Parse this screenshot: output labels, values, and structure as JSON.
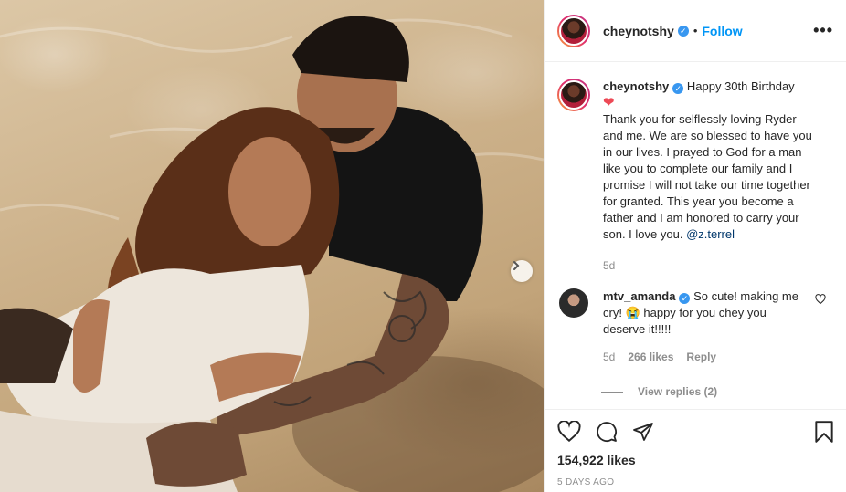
{
  "post": {
    "photo_alt": "photo",
    "next_icon": "chevron-right-icon"
  },
  "header": {
    "username": "cheynotshy",
    "verified_glyph": "✓",
    "separator": "•",
    "follow_label": "Follow",
    "more_label": "•••"
  },
  "caption": {
    "username": "cheynotshy",
    "first_line": "Happy 30th Birthday",
    "heart": "❤",
    "text": "Thank you for selflessly loving Ryder and me. We are so blessed to have you in our lives. I prayed to God for a man like you to complete our family and I promise I will not take our time together for granted. This year you become a father and I am honored to carry your son. I love you.",
    "mention": "@z.terrel",
    "time": "5d"
  },
  "comment": {
    "username": "mtv_amanda",
    "text_before_emoji": "So cute! making me cry!",
    "emoji": "😭",
    "text_after_emoji": "happy for you chey you deserve it!!!!!",
    "time": "5d",
    "likes": "266 likes",
    "reply_label": "Reply",
    "view_replies": "View replies (2)"
  },
  "footer": {
    "likes": "154,922 likes",
    "date": "5 DAYS AGO"
  },
  "colors": {
    "accent": "#0095f6",
    "verified": "#3897f0",
    "muted": "#8e8e8e",
    "heart": "#ed4956"
  }
}
